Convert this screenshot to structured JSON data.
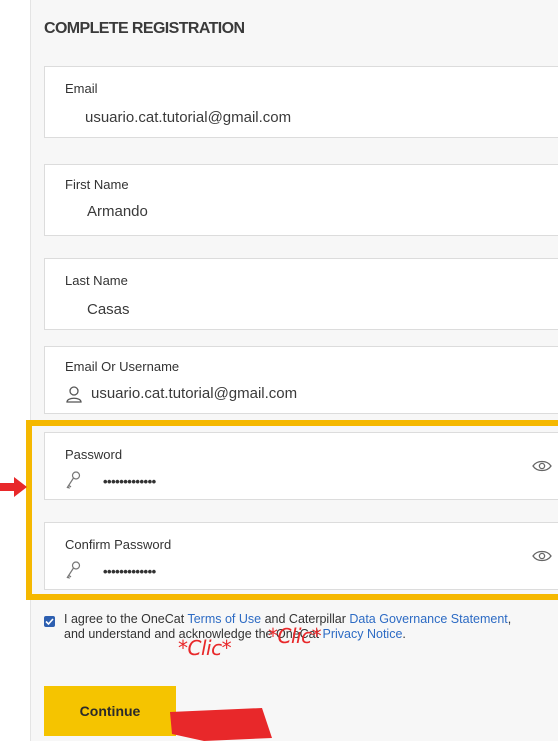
{
  "form": {
    "title": "COMPLETE REGISTRATION",
    "email": {
      "label": "Email",
      "value": "usuario.cat.tutorial@gmail.com"
    },
    "first_name": {
      "label": "First Name",
      "value": "Armando"
    },
    "last_name": {
      "label": "Last Name",
      "value": "Casas"
    },
    "username": {
      "label": "Email Or Username",
      "value": "usuario.cat.tutorial@gmail.com",
      "icon": "user-icon"
    },
    "password": {
      "label": "Password",
      "value": "•••••••••••••",
      "icon": "key-icon",
      "toggle_icon": "eye-icon"
    },
    "confirm_password": {
      "label": "Confirm Password",
      "value": "•••••••••••••",
      "icon": "key-icon",
      "toggle_icon": "eye-icon"
    },
    "agreement": {
      "checked": true,
      "text_1": "I agree to the OneCat ",
      "terms_link": "Terms of Use",
      "text_2": " and Caterpillar ",
      "data_gov_link": "Data Governance Statement",
      "text_3": ", and understand and acknowledge the OneCat ",
      "privacy_link": "Privacy Notice",
      "text_4": "."
    },
    "continue_label": "Continue"
  },
  "annotations": {
    "click_1": "*Clic*",
    "click_2": "*Clic*",
    "highlight_color": "#f5b800",
    "arrow_color": "#e8282a"
  },
  "colors": {
    "accent": "#f5c400",
    "link": "#2d6bc4",
    "panel_bg": "#f7f7f7"
  }
}
